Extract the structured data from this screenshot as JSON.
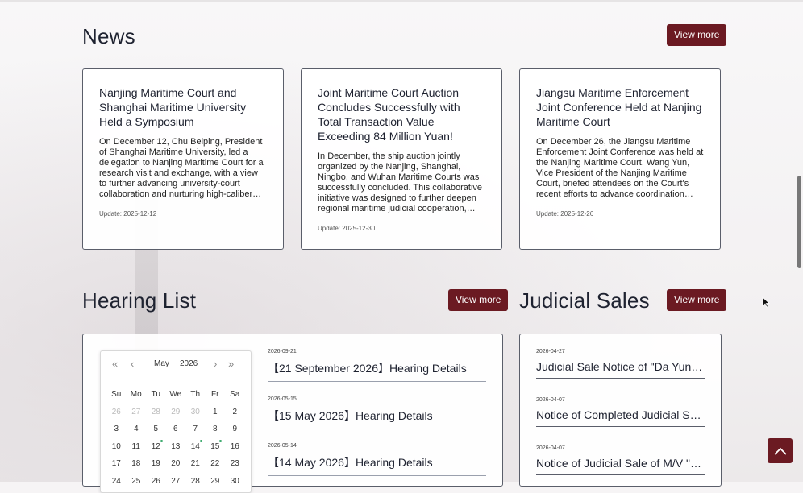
{
  "news": {
    "title": "News",
    "view_more": "View more",
    "items": [
      {
        "title": "Nanjing Maritime Court and Shanghai Maritime University Held a Symposium",
        "body": "On December 12, Chu Beiping, President of Shanghai Maritime University, led a delegation to Nanjing Maritime Court for a research visit and exchange, with a view to further advancing university-court collaboration and nurturing high-caliber…",
        "date": "Update: 2025-12-12"
      },
      {
        "title": "Joint Maritime Court Auction Concludes Successfully with Total Transaction Value Exceeding 84 Million Yuan!",
        "body": "In December, the ship auction jointly organized by the Nanjing, Shanghai, Ningbo, and Wuhan Maritime Courts was successfully concluded. This collaborative initiative was designed to further deepen regional maritime judicial cooperation,…",
        "date": "Update: 2025-12-30"
      },
      {
        "title": "Jiangsu Maritime Enforcement Joint Conference Held at Nanjing Maritime Court",
        "body": "On December 26, the Jiangsu Maritime Enforcement Joint Conference was held at the Nanjing Maritime Court. Wang Yun, Vice President of the Nanjing Maritime Court, briefed attendees on the Court's recent efforts to advance coordination…",
        "date": "Update: 2025-12-26"
      }
    ]
  },
  "hearing": {
    "title": "Hearing List",
    "view_more": "View more",
    "calendar": {
      "month": "May",
      "year": "2026",
      "weekdays": [
        "Su",
        "Mo",
        "Tu",
        "We",
        "Th",
        "Fr",
        "Sa"
      ],
      "days": [
        {
          "d": "26",
          "muted": true
        },
        {
          "d": "27",
          "muted": true
        },
        {
          "d": "28",
          "muted": true
        },
        {
          "d": "29",
          "muted": true
        },
        {
          "d": "30",
          "muted": true
        },
        {
          "d": "1"
        },
        {
          "d": "2"
        },
        {
          "d": "3"
        },
        {
          "d": "4"
        },
        {
          "d": "5"
        },
        {
          "d": "6"
        },
        {
          "d": "7"
        },
        {
          "d": "8"
        },
        {
          "d": "9"
        },
        {
          "d": "10"
        },
        {
          "d": "11"
        },
        {
          "d": "12",
          "dot": true
        },
        {
          "d": "13"
        },
        {
          "d": "14",
          "dot": true
        },
        {
          "d": "15",
          "dot": true
        },
        {
          "d": "16"
        },
        {
          "d": "17"
        },
        {
          "d": "18"
        },
        {
          "d": "19"
        },
        {
          "d": "20"
        },
        {
          "d": "21"
        },
        {
          "d": "22"
        },
        {
          "d": "23"
        },
        {
          "d": "24"
        },
        {
          "d": "25"
        },
        {
          "d": "26"
        },
        {
          "d": "27"
        },
        {
          "d": "28"
        },
        {
          "d": "29"
        },
        {
          "d": "30"
        }
      ]
    },
    "items": [
      {
        "date": "2026-09-21",
        "title": "【21 September 2026】Hearing Details"
      },
      {
        "date": "2026-05-15",
        "title": "【15 May 2026】Hearing Details"
      },
      {
        "date": "2026-05-14",
        "title": "【14 May 2026】Hearing Details"
      }
    ]
  },
  "sales": {
    "title": "Judicial Sales",
    "view_more": "View more",
    "items": [
      {
        "date": "2026-04-27",
        "title": "Judicial Sale Notice of \"Da Yun 0…"
      },
      {
        "date": "2026-04-07",
        "title": "Notice of Completed Judicial Sal…"
      },
      {
        "date": "2026-04-07",
        "title": "Notice of Judicial Sale of M/V \"Ji…"
      }
    ]
  },
  "icons": {
    "back_to_top": "chevron-up-icon",
    "calendar_nav": [
      "double-chevron-left-icon",
      "chevron-left-icon",
      "chevron-right-icon",
      "double-chevron-right-icon"
    ]
  },
  "colors": {
    "accent": "#6b1a22",
    "heading": "#1e2230",
    "event_dot": "#3aa86b"
  }
}
